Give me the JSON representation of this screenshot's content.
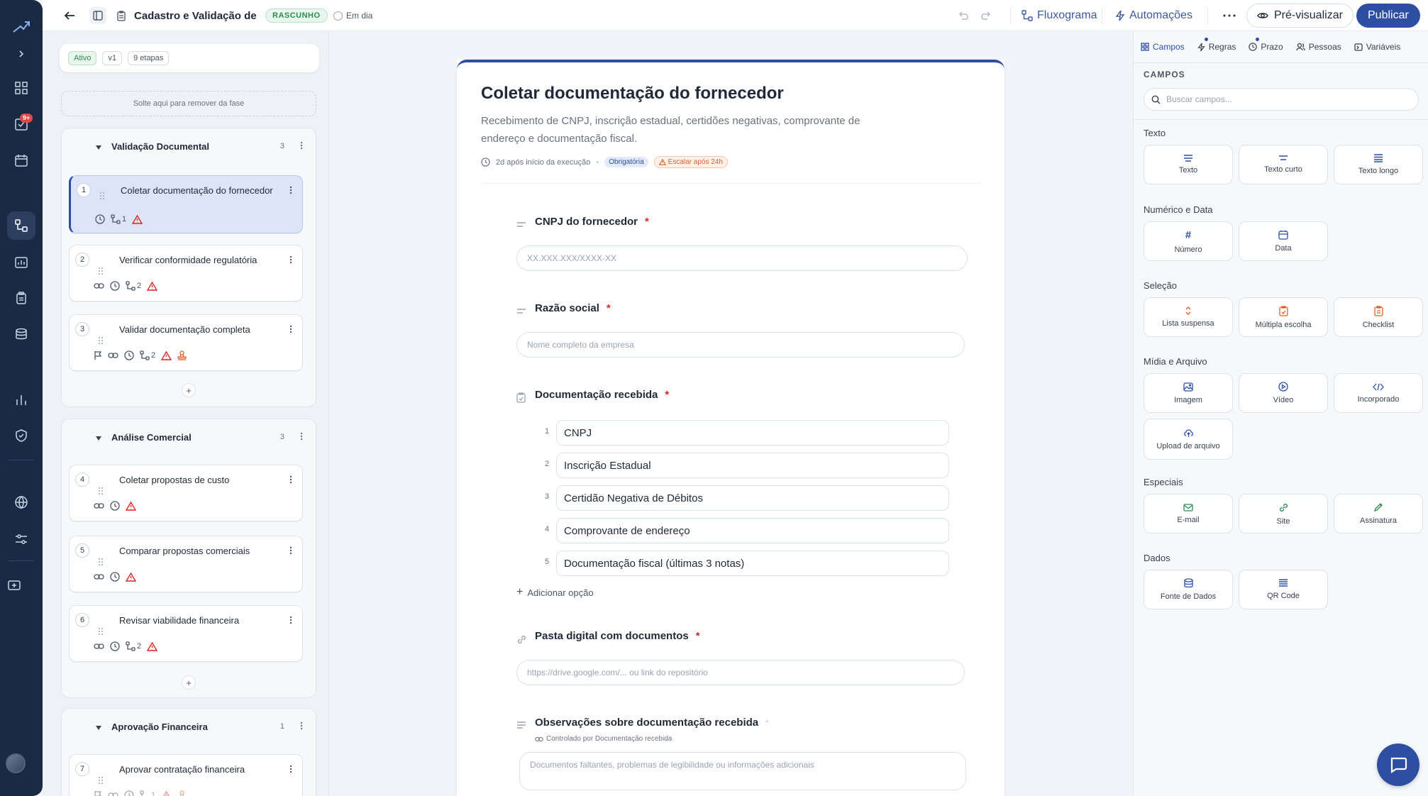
{
  "topbar": {
    "title": "Cadastro e Validação de",
    "status_badge": "RASCUNHO",
    "sla_status": "Em dia",
    "flowchart_label": "Fluxograma",
    "automations_label": "Automações",
    "preview_label": "Pré-visualizar",
    "publish_label": "Publicar"
  },
  "rail": {
    "notification_badge": "9+"
  },
  "left": {
    "status_chips": [
      "Ativo",
      "v1",
      "9 etapas"
    ],
    "dropzone_text": "Solte aqui para remover da fase",
    "phases": [
      {
        "title": "Validação Documental",
        "count": "3",
        "steps": [
          {
            "num": "1",
            "title": "Coletar documentação do fornecedor",
            "rules": "1"
          },
          {
            "num": "2",
            "title": "Verificar conformidade regulatória",
            "rules": "2"
          },
          {
            "num": "3",
            "title": "Validar documentação completa",
            "rules": "2"
          }
        ],
        "add": "+"
      },
      {
        "title": "Análise Comercial",
        "count": "3",
        "steps": [
          {
            "num": "4",
            "title": "Coletar propostas de custo"
          },
          {
            "num": "5",
            "title": "Comparar propostas comerciais"
          },
          {
            "num": "6",
            "title": "Revisar viabilidade financeira",
            "rules": "2"
          }
        ],
        "add": "+"
      },
      {
        "title": "Aprovação Financeira",
        "count": "1",
        "steps": [
          {
            "num": "7",
            "title": "Aprovar contratação financeira",
            "rules": "1"
          }
        ]
      }
    ]
  },
  "form": {
    "title": "Coletar documentação do fornecedor",
    "description": "Recebimento de CNPJ, inscrição estadual, certidões negativas, comprovante de endereço e documentação fiscal.",
    "timing": "2d após início da execução",
    "tag_required": "Obrigatória",
    "tag_escalate": "Escalar após 24h",
    "fields": {
      "cnpj": {
        "label": "CNPJ do fornecedor",
        "placeholder": "XX.XXX.XXX/XXXX-XX"
      },
      "razao": {
        "label": "Razão social",
        "placeholder": "Nome completo da empresa"
      },
      "docs": {
        "label": "Documentação recebida",
        "options": [
          {
            "n": "1",
            "text": "CNPJ"
          },
          {
            "n": "2",
            "text": "Inscrição Estadual"
          },
          {
            "n": "3",
            "text": "Certidão Negativa de Débitos"
          },
          {
            "n": "4",
            "text": "Comprovante de endereço"
          },
          {
            "n": "5",
            "text": "Documentação fiscal (últimas 3 notas)"
          }
        ],
        "add_option": "Adicionar opção"
      },
      "pasta": {
        "label": "Pasta digital com documentos",
        "placeholder": "https://drive.google.com/... ou link do repositório"
      },
      "obs": {
        "label": "Observações sobre documentação recebida",
        "controlled_by": "Controlado por Documentação recebida",
        "placeholder": "Documentos faltantes, problemas de legibilidade ou informações adicionais"
      }
    },
    "required_mark": "*"
  },
  "right": {
    "tabs": [
      "Campos",
      "Regras",
      "Prazo",
      "Pessoas",
      "Variáveis"
    ],
    "heading": "CAMPOS",
    "search_placeholder": "Buscar campos...",
    "groups": [
      {
        "title": "Texto",
        "items": [
          {
            "label": "Texto",
            "icon": "text-icon"
          },
          {
            "label": "Texto curto",
            "icon": "short-text-icon"
          },
          {
            "label": "Texto longo",
            "icon": "long-text-icon"
          }
        ]
      },
      {
        "title": "Numérico e Data",
        "items": [
          {
            "label": "Número",
            "icon": "hash-icon"
          },
          {
            "label": "Data",
            "icon": "calendar-icon"
          }
        ]
      },
      {
        "title": "Seleção",
        "items": [
          {
            "label": "Lista suspensa",
            "icon": "dropdown-icon"
          },
          {
            "label": "Múltipla escolha",
            "icon": "clipboard-icon"
          },
          {
            "label": "Checklist",
            "icon": "checklist-icon"
          }
        ]
      },
      {
        "title": "Mídia e Arquivo",
        "items": [
          {
            "label": "Imagem",
            "icon": "image-icon"
          },
          {
            "label": "Vídeo",
            "icon": "video-icon"
          },
          {
            "label": "Incorporado",
            "icon": "code-icon"
          },
          {
            "label": "Upload de arquivo",
            "icon": "upload-icon"
          }
        ]
      },
      {
        "title": "Especiais",
        "items": [
          {
            "label": "E-mail",
            "icon": "mail-icon"
          },
          {
            "label": "Site",
            "icon": "link-icon"
          },
          {
            "label": "Assinatura",
            "icon": "pen-icon"
          }
        ]
      },
      {
        "title": "Dados",
        "items": [
          {
            "label": "Fonte de Dados",
            "icon": "database-icon"
          },
          {
            "label": "QR Code",
            "icon": "qr-icon"
          }
        ]
      }
    ]
  },
  "colors": {
    "accent": "#2d4ea3",
    "rail": "#1b2a44",
    "warning": "#dc2626",
    "orange": "#d9652a",
    "green": "#2f8a55"
  }
}
